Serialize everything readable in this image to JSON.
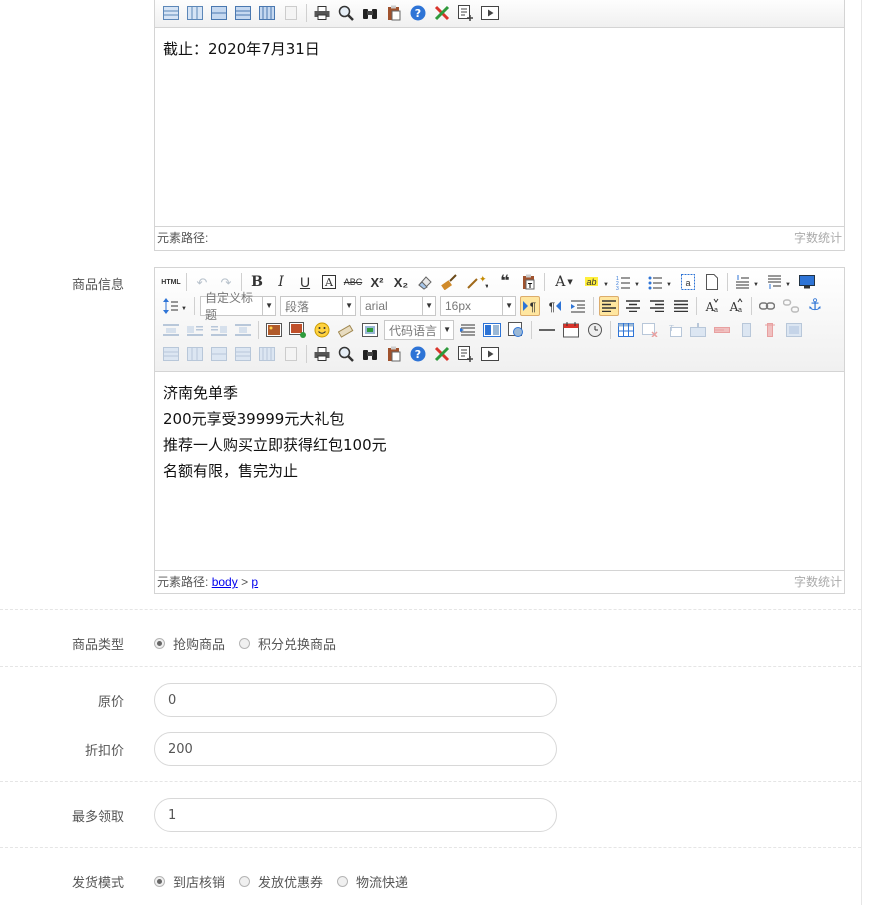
{
  "editor1": {
    "content_lines": [
      "截止：2020年7月31日"
    ],
    "status_path_label": "元素路径:",
    "status_count_label": "字数统计"
  },
  "goods_info": {
    "label": "商品信息",
    "toolbar": {
      "html_label": "HTML",
      "custom_heading": "自定义标题",
      "paragraph": "段落",
      "font_family": "arial",
      "font_size": "16px",
      "code_language": "代码语言"
    },
    "content_lines": [
      "济南免单季",
      "200元享受39999元大礼包",
      "推荐一人购买立即获得红包100元",
      "名额有限，售完为止"
    ],
    "status_path_label": "元素路径:",
    "status_path_body": "body",
    "status_path_sep": ">",
    "status_path_p": "p",
    "status_count_label": "字数统计"
  },
  "goods_type": {
    "label": "商品类型",
    "options": [
      "抢购商品",
      "积分兑换商品"
    ],
    "selected": "抢购商品"
  },
  "original_price": {
    "label": "原价",
    "value": "0"
  },
  "discount_price": {
    "label": "折扣价",
    "value": "200"
  },
  "max_claim": {
    "label": "最多领取",
    "value": "1"
  },
  "delivery_mode": {
    "label": "发货模式",
    "options": [
      "到店核销",
      "发放优惠券",
      "物流快递"
    ],
    "selected": "到店核销"
  },
  "colors": {
    "active_button": "#ffe69f",
    "border": "#d4d4d4"
  },
  "icons": [
    "print-icon",
    "preview-icon",
    "search-replace-icon",
    "paste-icon",
    "help-icon",
    "clear-icon",
    "template-icon",
    "video-icon"
  ]
}
